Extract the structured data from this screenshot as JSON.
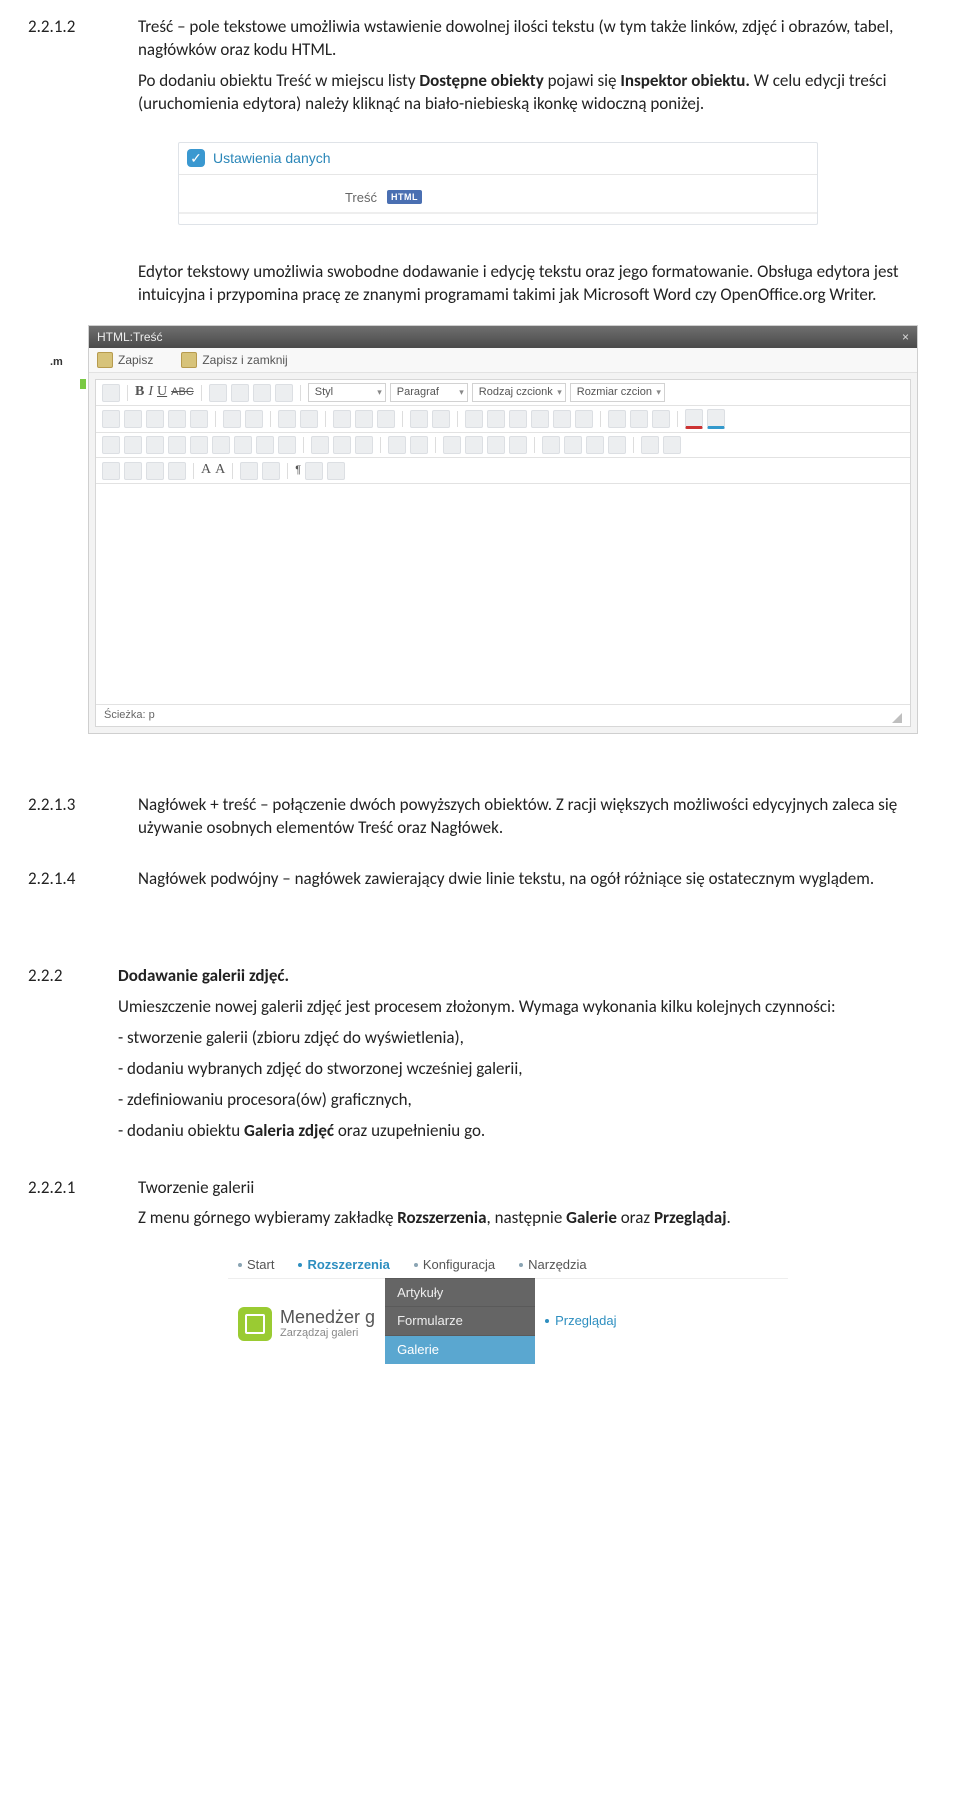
{
  "sec_2212": {
    "num": "2.2.1.2",
    "p1_a": "Treść – pole tekstowe umożliwia wstawienie dowolnej ilości tekstu (w tym także linków, zdjęć i obrazów, tabel, nagłówków oraz kodu HTML.",
    "p2_a": "Po dodaniu obiektu Treść w miejscu listy ",
    "p2_b": "Dostępne obiekty",
    "p2_c": " pojawi się ",
    "p2_d": "Inspektor obiektu.",
    "p2_e": " W celu edycji treści (uruchomienia edytora) należy kliknąć na biało-niebieską ikonkę widoczną poniżej.",
    "p3_a": "Edytor tekstowy umożliwia swobodne dodawanie i edycję tekstu oraz jego formatowanie. Obsługa edytora jest intuicyjna i przypomina pracę ze znanymi programami takimi jak Microsoft Word czy OpenOffice.org Writer."
  },
  "panel1": {
    "title": "Ustawienia danych",
    "field_label": "Treść",
    "badge": "HTML"
  },
  "editor": {
    "title": "HTML:Treść",
    "save": "Zapisz",
    "save_close": "Zapisz i zamknij",
    "dd_style": "Styl",
    "dd_para": "Paragraf",
    "dd_font": "Rodzaj czcionk",
    "dd_size": "Rozmiar czcion",
    "status": "Ścieżka: p",
    "side_m": ".m"
  },
  "sec_2213": {
    "num": "2.2.1.3",
    "t": "Nagłówek + treść – połączenie dwóch powyższych obiektów. Z racji większych możliwości edycyjnych zaleca się używanie osobnych elementów Treść oraz Nagłówek."
  },
  "sec_2214": {
    "num": "2.2.1.4",
    "t": "Nagłówek podwójny – nagłówek zawierający dwie linie tekstu, na ogół różniące się ostatecznym wyglądem."
  },
  "sec_222": {
    "num": "2.2.2",
    "h": "Dodawanie galerii zdjęć.",
    "l1": "Umieszczenie nowej galerii zdjęć jest procesem złożonym. Wymaga wykonania kilku kolejnych czynności:",
    "b1": "- stworzenie galerii (zbioru zdjęć do wyświetlenia),",
    "b2": "- dodaniu wybranych zdjęć do stworzonej wcześniej galerii,",
    "b3": "- zdefiniowaniu procesora(ów) graficznych,",
    "b4a": "- dodaniu obiektu ",
    "b4b": "Galeria zdjęć",
    "b4c": " oraz uzupełnieniu go."
  },
  "sec_2221": {
    "num": "2.2.2.1",
    "h": "Tworzenie galerii",
    "t_a": "Z menu górnego wybieramy zakładkę ",
    "t_b": "Rozszerzenia",
    "t_c": ", następnie ",
    "t_d": "Galerie",
    "t_e": " oraz ",
    "t_f": "Przeglądaj",
    "t_g": "."
  },
  "menu": {
    "top": {
      "start": "Start",
      "ext": "Rozszerzenia",
      "conf": "Konfiguracja",
      "tools": "Narzędzia"
    },
    "brand_t": "Menedżer g",
    "brand_s": "Zarządzaj galeri",
    "dd": {
      "art": "Artykuły",
      "form": "Formularze",
      "gal": "Galerie"
    },
    "browse": "Przeglądaj"
  }
}
